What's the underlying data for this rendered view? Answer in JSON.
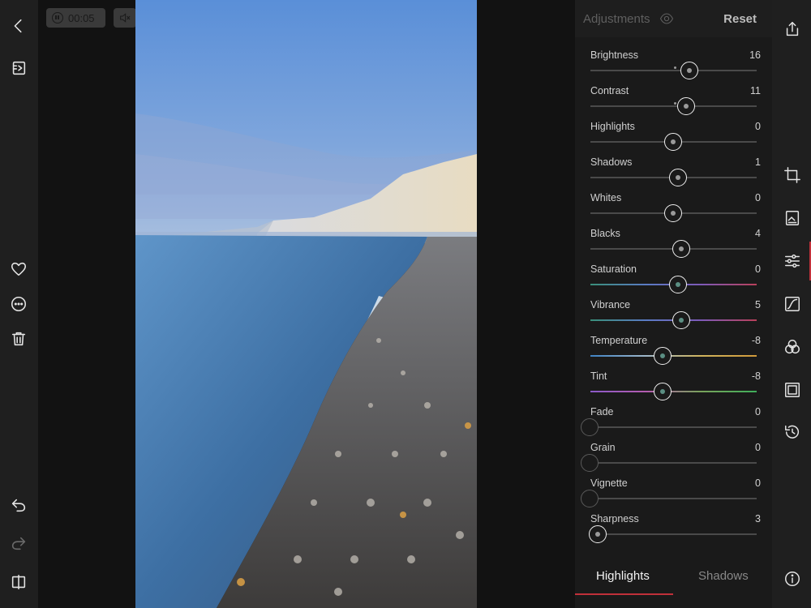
{
  "player": {
    "timer": "00:05",
    "pause_icon": "pause-icon",
    "mute_icon": "mute-icon"
  },
  "left_rail": {
    "icons": [
      "back-icon",
      "navigator-icon",
      "heart-icon",
      "more-icon",
      "trash-icon",
      "undo-icon",
      "redo-icon",
      "compare-icon"
    ]
  },
  "panel": {
    "title": "Adjustments",
    "reset_label": "Reset",
    "sliders": [
      {
        "label": "Brightness",
        "value": "16",
        "position": 0.6
      },
      {
        "label": "Contrast",
        "value": "11",
        "position": 0.58
      },
      {
        "label": "Highlights",
        "value": "0",
        "position": 0.5
      },
      {
        "label": "Shadows",
        "value": "1",
        "position": 0.53
      },
      {
        "label": "Whites",
        "value": "0",
        "position": 0.5
      },
      {
        "label": "Blacks",
        "value": "4",
        "position": 0.55
      },
      {
        "label": "Saturation",
        "value": "0",
        "position": 0.53
      },
      {
        "label": "Vibrance",
        "value": "5",
        "position": 0.55
      },
      {
        "label": "Temperature",
        "value": "-8",
        "position": 0.44
      },
      {
        "label": "Tint",
        "value": "-8",
        "position": 0.44
      },
      {
        "label": "Fade",
        "value": "0",
        "position": 0.0
      },
      {
        "label": "Grain",
        "value": "0",
        "position": 0.0
      },
      {
        "label": "Vignette",
        "value": "0",
        "position": 0.0
      },
      {
        "label": "Sharpness",
        "value": "3",
        "position": 0.05
      }
    ],
    "tabs": [
      {
        "label": "Highlights",
        "active": true
      },
      {
        "label": "Shadows",
        "active": false
      }
    ]
  },
  "right_rail": {
    "icons": [
      "share-icon",
      "crop-icon",
      "image-icon",
      "adjust-icon",
      "curves-icon",
      "color-mix-icon",
      "frame-icon",
      "history-icon",
      "info-icon"
    ]
  },
  "colors": {
    "accent": "#c0303a",
    "panel_bg": "#1a1a1a"
  }
}
